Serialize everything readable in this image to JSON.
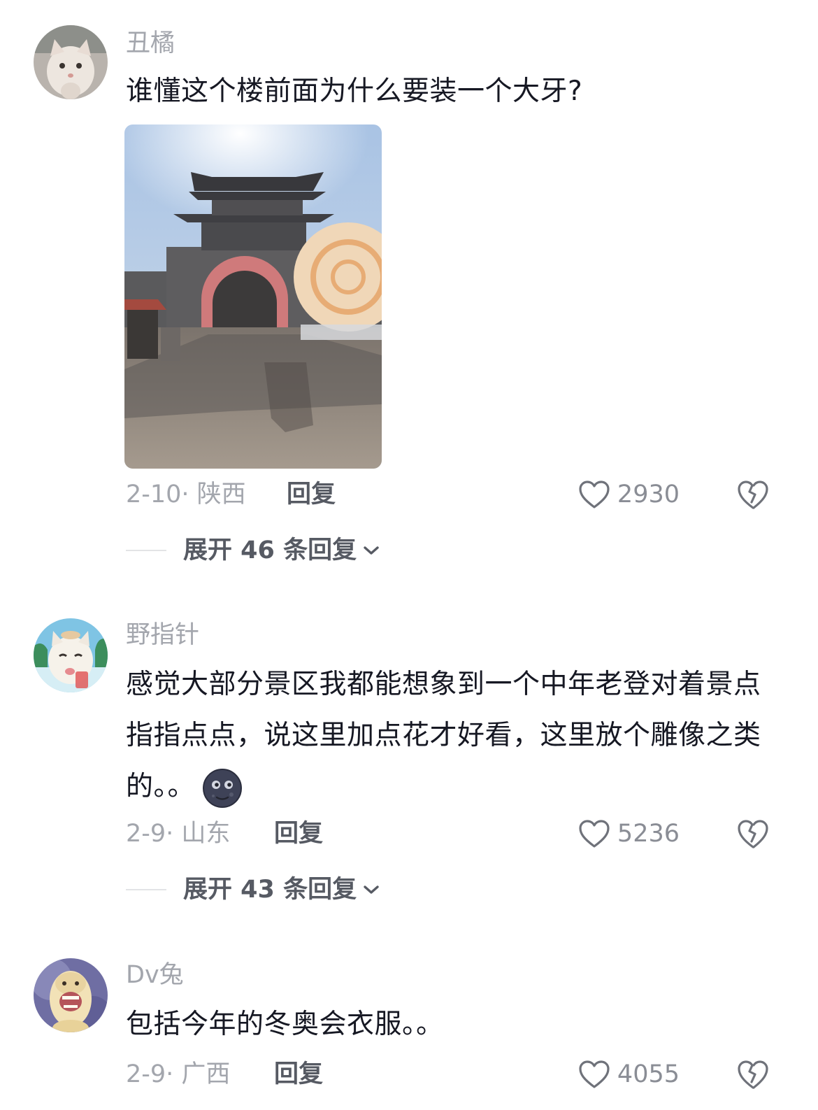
{
  "comments": [
    {
      "username": "丑橘",
      "text": "谁懂这个楼前面为什么要装一个大牙?",
      "date_location": "2-10· 陕西",
      "reply_label": "回复",
      "likes": "2930",
      "expand_label": "展开 46 条回复",
      "avatar_icon": "cat-avatar-icon",
      "image_icon": "city-gate-photo"
    },
    {
      "username": "野指针",
      "text": "感觉大部分景区我都能想象到一个中年老登对着景点指指点点，说这里加点花才好看，这里放个雕像之类的。。",
      "emoji": "new-moon-face-emoji",
      "date_location": "2-9· 山东",
      "reply_label": "回复",
      "likes": "5236",
      "expand_label": "展开 43 条回复",
      "avatar_icon": "cat-drink-avatar-icon"
    },
    {
      "username": "Dv兔",
      "text": "包括今年的冬奥会衣服。。",
      "date_location": "2-9· 广西",
      "reply_label": "回复",
      "likes": "4055",
      "avatar_icon": "dog-avatar-icon"
    }
  ],
  "colors": {
    "username": "#a3a6ad",
    "text": "#161823",
    "meta": "#a3a6ad",
    "reply": "#565a63"
  }
}
